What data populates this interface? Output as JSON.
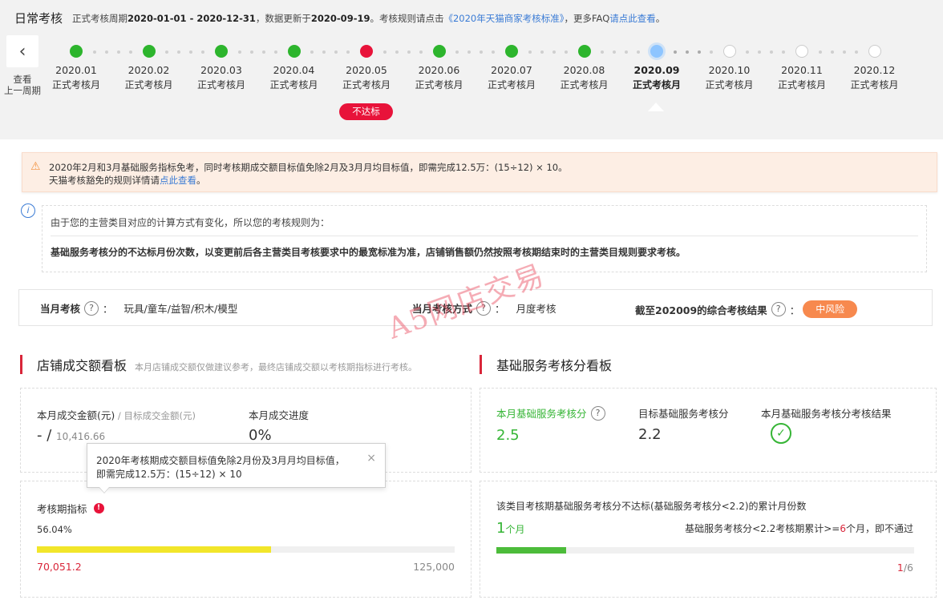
{
  "header": {
    "title": "日常考核",
    "period_prefix": "正式考核周期",
    "period": "2020-01-01 - 2020-12-31",
    "updated_prefix": "，数据更新于",
    "updated": "2020-09-19",
    "rule_prefix": "。考核规则请点击",
    "rule_link": "《2020年天猫商家考核标准》",
    "faq_prefix": "，更多FAQ",
    "faq_link": "请点此查看",
    "faq_suffix": "。"
  },
  "timeline": {
    "prev_label_1": "查看",
    "prev_label_2": "上一周期",
    "months": [
      {
        "ym": "2020.01",
        "status": "正式考核月",
        "state": "pass"
      },
      {
        "ym": "2020.02",
        "status": "正式考核月",
        "state": "pass"
      },
      {
        "ym": "2020.03",
        "status": "正式考核月",
        "state": "pass"
      },
      {
        "ym": "2020.04",
        "status": "正式考核月",
        "state": "pass"
      },
      {
        "ym": "2020.05",
        "status": "正式考核月",
        "state": "fail"
      },
      {
        "ym": "2020.06",
        "status": "正式考核月",
        "state": "pass"
      },
      {
        "ym": "2020.07",
        "status": "正式考核月",
        "state": "pass"
      },
      {
        "ym": "2020.08",
        "status": "正式考核月",
        "state": "pass"
      },
      {
        "ym": "2020.09",
        "status": "正式考核月",
        "state": "current"
      },
      {
        "ym": "2020.10",
        "status": "正式考核月",
        "state": "future"
      },
      {
        "ym": "2020.11",
        "status": "正式考核月",
        "state": "future"
      },
      {
        "ym": "2020.12",
        "status": "正式考核月",
        "state": "future"
      }
    ],
    "fail_badge": "不达标"
  },
  "warning": {
    "line1": "2020年2月和3月基础服务指标免考，同时考核期成交额目标值免除2月及3月月均目标值，即需完成12.5万：(15÷12) × 10。",
    "line2_prefix": "天猫考核豁免的规则详情请",
    "line2_link": "点此查看",
    "line2_suffix": "。"
  },
  "notice": {
    "line1": "由于您的主营类目对应的计算方式有变化，所以您的考核规则为：",
    "line2": "基础服务考核分的不达标月份次数，以变更前后各主营类目考核要求中的最宽标准为准，店铺销售额仍然按照考核期结束时的主营类目规则要求考核。"
  },
  "filters": {
    "month_label": "当月考核",
    "month_value": "玩具/童车/益智/积木/模型",
    "method_label": "当月考核方式",
    "method_value": "月度考核",
    "result_label": "截至202009的综合考核结果",
    "result_value": "中风险",
    "colon": "："
  },
  "watermark": "A5网店交易",
  "sales": {
    "title": "店铺成交额看板",
    "hint": "本月店铺成交额仅做建议参考，最终店铺成交额以考核期指标进行考核。",
    "amount_label": "本月成交金额(元)",
    "amount_sep": " / ",
    "target_label": "目标成交金额(元)",
    "amount_value": "-",
    "amount_slash": "/",
    "target_value": "10,416.66",
    "progress_label": "本月成交进度",
    "progress_value": "0%",
    "tooltip_line1": "2020年考核期成交额目标值免除2月份及3月月均目标值，",
    "tooltip_line2": "即需完成12.5万：(15÷12) × 10",
    "tooltip_close": "×",
    "period_label": "考核期指标",
    "period_percent": "56.04%",
    "period_progress": 0.5604,
    "period_current": "70,051.2",
    "period_target": "125,000"
  },
  "service": {
    "title": "基础服务考核分看板",
    "score_label": "本月基础服务考核分",
    "score_value": "2.5",
    "target_label": "目标基础服务考核分",
    "target_value": "2.2",
    "result_label": "本月基础服务考核分考核结果",
    "fail_count_label": "该类目考核期基础服务考核分不达标(基础服务考核分<2.2)的累计月份数",
    "fail_count_value": "1",
    "fail_count_unit": "个月",
    "rule_prefix": "基础服务考核分<2.2考核期累计>=",
    "rule_num": "6",
    "rule_suffix": "个月，即不通过",
    "ratio_num": "1",
    "ratio_den": "/6",
    "ratio_progress": 0.1667
  },
  "colors": {
    "pass": "#2db52d",
    "fail": "#e8133a",
    "link": "#3a7bd5",
    "risk": "#f7894e",
    "sales_bar": "#f2e62a",
    "service_bar": "#4cbc3a"
  }
}
